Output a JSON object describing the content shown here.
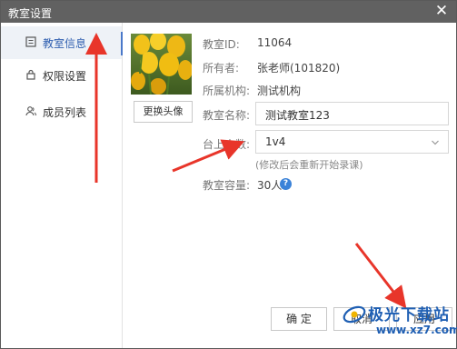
{
  "window": {
    "title": "教室设置",
    "close_glyph": "✕"
  },
  "sidebar": {
    "items": [
      {
        "label": "教室信息",
        "icon": "document-icon",
        "active": true
      },
      {
        "label": "权限设置",
        "icon": "lock-icon",
        "active": false
      },
      {
        "label": "成员列表",
        "icon": "users-icon",
        "active": false
      }
    ]
  },
  "info": {
    "change_avatar": "更换头像",
    "id_label": "教室ID:",
    "id_value": "11064",
    "owner_label": "所有者:",
    "owner_value": "张老师(101820)",
    "org_label": "所属机构:",
    "org_value": "测试机构",
    "name_label": "教室名称:",
    "name_value": "测试教室123",
    "seats_label": "台上人数:",
    "seats_value": "1v4",
    "seats_hint": "(修改后会重新开始录课)",
    "capacity_label": "教室容量:",
    "capacity_value": "30人",
    "help_glyph": "?"
  },
  "footer": {
    "ok_label": "确 定",
    "cancel_label": "取消",
    "apply_label": "应用"
  },
  "watermark": {
    "text": "极光下载站",
    "url": "www.xz7.com"
  },
  "colors": {
    "titlebar": "#616161",
    "accent": "#4a78c9",
    "arrow": "#e8352a",
    "help": "#3a82d8"
  }
}
